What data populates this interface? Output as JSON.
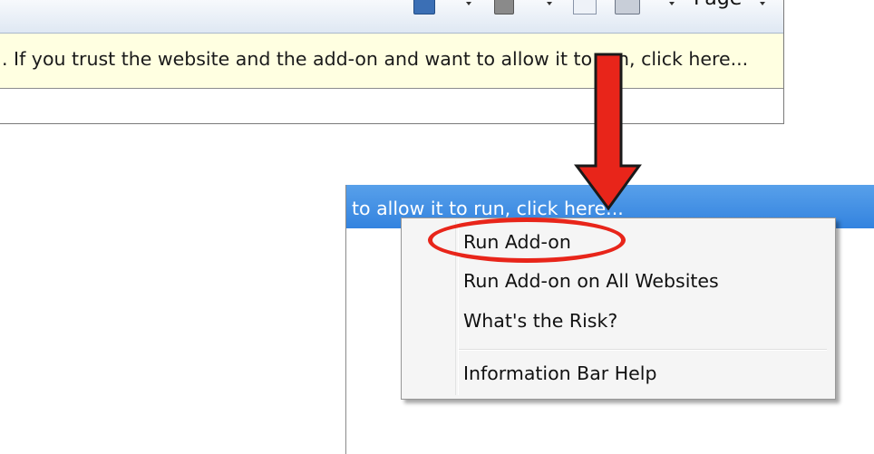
{
  "toolbar": {
    "page_menu_label": "Page",
    "icons": [
      "home-icon",
      "feeds-icon",
      "mail-icon",
      "print-icon"
    ]
  },
  "info_bar": {
    "message": ". If you trust the website and the add-on and want to allow it to run, click here..."
  },
  "zoomed_info_bar": {
    "message_fragment": "to allow it to run, click here..."
  },
  "context_menu": {
    "items": [
      {
        "label": "Run Add-on"
      },
      {
        "label": "Run Add-on on All Websites"
      },
      {
        "label": "What's the Risk?"
      },
      {
        "label": "Information Bar Help"
      }
    ]
  },
  "colors": {
    "info_bar_background": "#ffffe1",
    "selected_bar": "#3b8ce4",
    "annotation_red": "#e8251a"
  }
}
